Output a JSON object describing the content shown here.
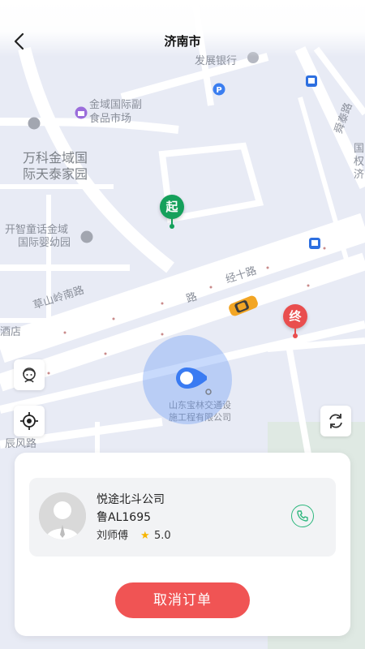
{
  "header": {
    "title": "济南市",
    "back_icon": "chevron-left-icon"
  },
  "map": {
    "labels": {
      "bank": "发展银行",
      "mall_line1": "金域国际副",
      "mall_line2": "食品市场",
      "residence_line1": "万科金域国",
      "residence_line2": "际天泰家园",
      "kinder_line1": "开智童话金域",
      "kinder_line2": "国际婴幼园",
      "road_caoshanling": "草山岭南路",
      "road_jingshi": "经十路",
      "road_lu": "路",
      "road_shuntai": "舜泰路",
      "road_chenfeng": "辰风路",
      "right_edge_1": "国",
      "right_edge_2": "权",
      "right_edge_3": "济",
      "hotel_fragment": "酒店",
      "company_line1": "山东宝林交通设",
      "company_line2": "施工程有限公司"
    },
    "start_pin": "起",
    "end_pin": "终",
    "colors": {
      "start": "#15a05b",
      "end": "#e94e4e",
      "location": "#3a7bf2",
      "taxi": "#f2a524"
    }
  },
  "controls": {
    "service_icon": "customer-service-icon",
    "locate_icon": "locate-icon",
    "refresh_icon": "refresh-icon"
  },
  "driver": {
    "company": "悦途北斗公司",
    "plate": "鲁AL1695",
    "name": "刘师傅",
    "rating": "5.0",
    "star": "★",
    "call_icon": "phone-icon"
  },
  "actions": {
    "cancel_label": "取消订单"
  }
}
